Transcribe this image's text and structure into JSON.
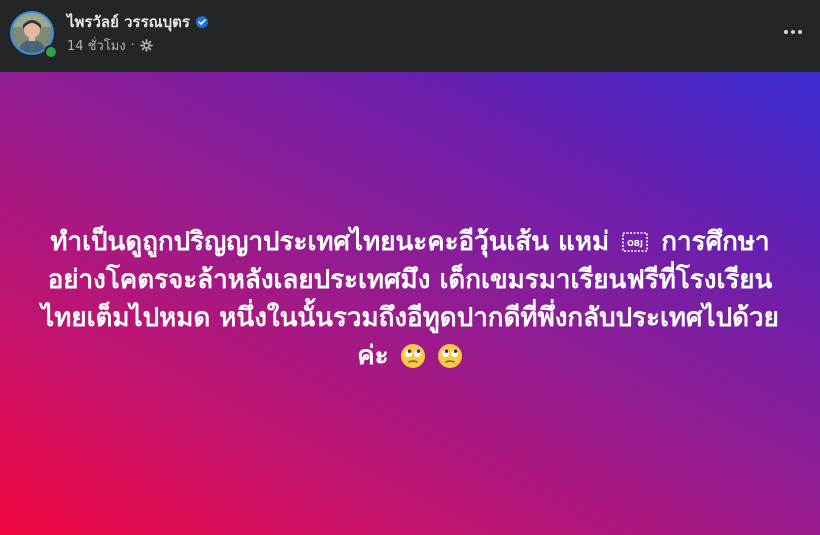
{
  "post": {
    "author_name": "ไพรวัลย์ วรรณบุตร",
    "timestamp": "14 ชั่วโมง",
    "meta_separator": "·",
    "text_part1": "ทำเป็นดูถูกปริญญาประเทศไทยนะคะอีวุ้นเส้น แหม่",
    "obj_glyph": "OBJ",
    "text_part2": "การศึกษาอย่างโคตรจะล้าหลังเลยประเทศมึง เด็กเขมรมาเรียนฟรีที่โรงเรียนไทยเต็มไปหมด หนึ่งในนั้นรวมถึงอีทูดปากดีที่พึ่งกลับประเทศไปด้วยค่ะ",
    "emojis": [
      "eye-roll-emoji",
      "eye-roll-emoji"
    ],
    "icons": {
      "verified": "verified-badge-icon",
      "audience": "public-settings-icon",
      "more": "more-options-icon"
    },
    "colors": {
      "header_bg": "#242526",
      "text_primary": "#e4e6eb",
      "text_secondary": "#b0b3b8",
      "verified_blue": "#1b74e4",
      "gradient": [
        "#f2063f",
        "#8d1d96",
        "#3a2bd1"
      ]
    }
  }
}
